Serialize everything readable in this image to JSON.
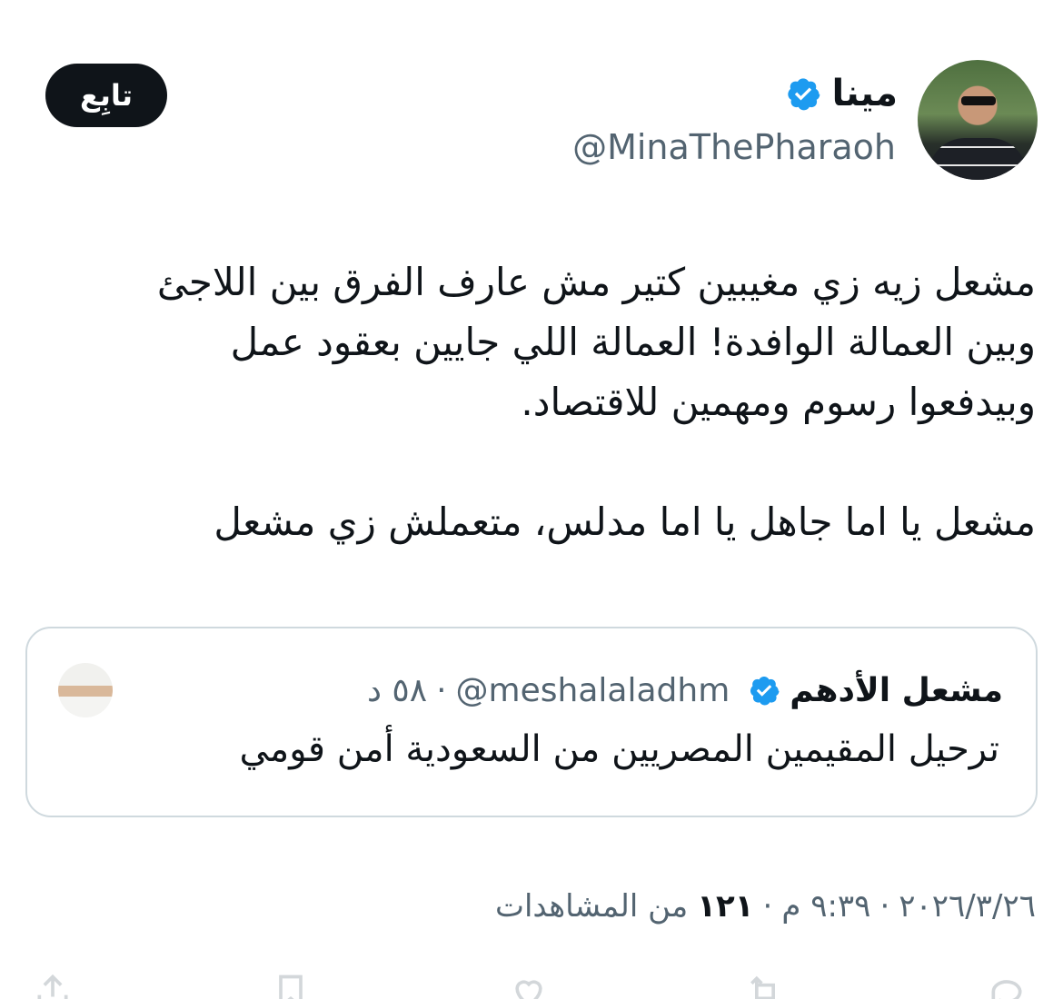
{
  "author": {
    "display_name": "مينا",
    "handle": "@MinaThePharaoh",
    "verified_color": "#1d9bf0"
  },
  "follow_button": {
    "label": "تابِع"
  },
  "tweet": {
    "lines": [
      "مشعل زيه زي مغيبين كتير مش عارف الفرق بين اللاجئ",
      "وبين العمالة الوافدة! العمالة اللي جايين بعقود عمل",
      "وبيدفعوا رسوم ومهمين للاقتصاد.",
      "مشعل يا اما جاهل يا اما مدلس، متعملش زي مشعل"
    ]
  },
  "quoted_tweet": {
    "display_name": "مشعل الأدهم",
    "handle": "@meshalaladhm",
    "time": "٥٨ د",
    "separator": "·",
    "text": "ترحيل المقيمين المصريين من السعودية أمن قومي"
  },
  "meta": {
    "date": "٢٠٢٦/٣/٢٦",
    "time": "٩:٣٩ م",
    "views_count": "١٢١",
    "views_label": "من المشاهدات",
    "separator": "·"
  },
  "actions": [
    {
      "icon": "reply-icon",
      "count": ""
    },
    {
      "icon": "retweet-icon",
      "count": ""
    },
    {
      "icon": "like-icon",
      "count": ""
    },
    {
      "icon": "bookmark-icon",
      "count": ""
    },
    {
      "icon": "share-icon",
      "count": ""
    }
  ]
}
